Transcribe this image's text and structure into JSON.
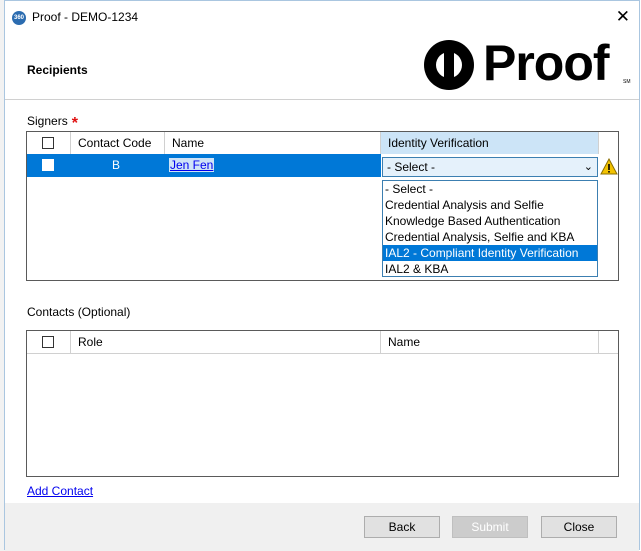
{
  "window": {
    "title": "Proof - DEMO-1234",
    "app_icon_text": "360"
  },
  "header": {
    "section_title": "Recipients",
    "logo_text": "Proof",
    "logo_mark": "SM"
  },
  "signers": {
    "label": "Signers",
    "required_mark": "*",
    "columns": [
      "Contact Code",
      "Name",
      "Identity Verification"
    ],
    "row": {
      "contact_code": "B",
      "name": "Jen Fen",
      "identity_verification": "- Select -"
    },
    "warning_icon": "warning-icon",
    "dropdown_options": [
      "- Select -",
      "Credential Analysis and Selfie",
      "Knowledge Based Authentication",
      "Credential Analysis, Selfie and KBA",
      "IAL2 - Compliant Identity Verification",
      "IAL2 & KBA"
    ],
    "highlighted_option": "IAL2 - Compliant Identity Verification"
  },
  "contacts": {
    "label": "Contacts (Optional)",
    "columns": [
      "Role",
      "Name"
    ],
    "add_link": "Add Contact"
  },
  "buttons": {
    "back": "Back",
    "submit": "Submit",
    "close": "Close"
  },
  "colors": {
    "selection": "#0078d7",
    "header_highlight": "#cce4f7",
    "required": "#e01010",
    "link": "#0000ee"
  }
}
